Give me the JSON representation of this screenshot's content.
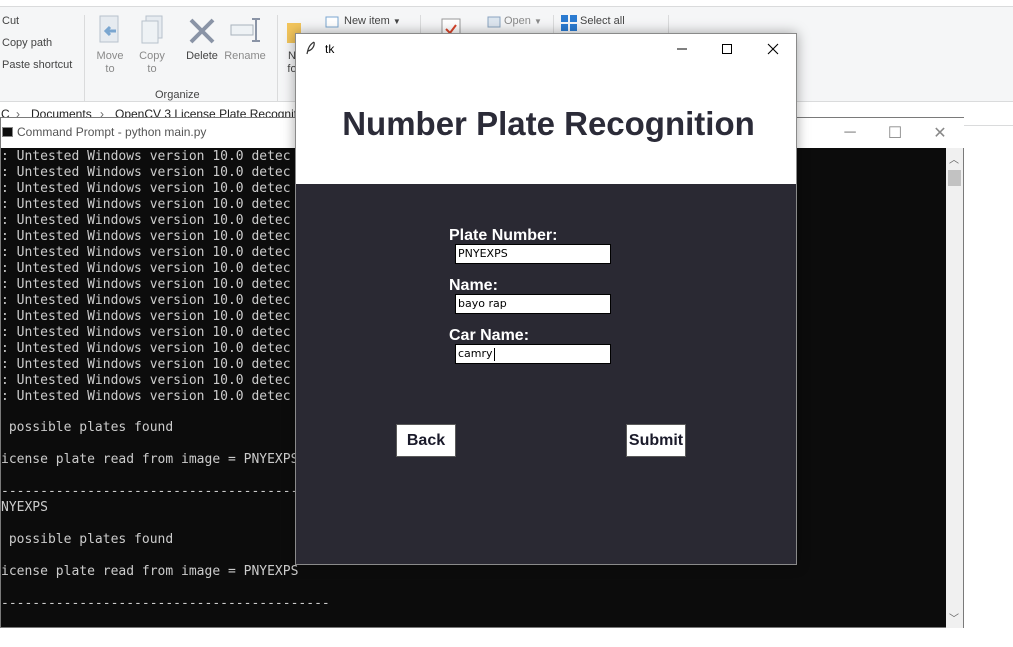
{
  "explorer": {
    "clipboard": {
      "cut": "Cut",
      "copy_path": "Copy path",
      "paste_shortcut": "Paste shortcut"
    },
    "organize": {
      "move_to": "Move to",
      "copy_to": "Copy to",
      "delete": "Delete",
      "rename": "Rename",
      "new_folder_partial": "N fo",
      "group_label": "Organize"
    },
    "new_group": {
      "new_item": "New item",
      "easy_access": ""
    },
    "open_group": {
      "open": "Open"
    },
    "select_group": {
      "select_all": "Select all"
    },
    "address": [
      "C",
      "Documents",
      "OpenCV 3 License Plate Recogniti"
    ]
  },
  "cmd": {
    "title": "Command Prompt - python  main.py",
    "repeated_line": ": Untested Windows version 10.0 detec",
    "repeat_count": 16,
    "lines_after": [
      " possible plates found",
      "icense plate read from image = PNYEXPS",
      "------------------------------------------------",
      "NYEXPS",
      " possible plates found",
      "icense plate read from image = PNYEXPS",
      "------------------------------------------"
    ]
  },
  "tk": {
    "window_title": "tk",
    "app_title": "Number Plate Recognition",
    "fields": {
      "plate": {
        "label": "Plate Number:",
        "value": "PNYEXPS"
      },
      "name": {
        "label": "Name:",
        "value": "bayo rap"
      },
      "car": {
        "label": "Car Name:",
        "value": "camry"
      }
    },
    "back_label": "Back",
    "submit_label": "Submit"
  },
  "colors": {
    "form_background": "#2a2933",
    "title_text": "#2b2b38",
    "console_background": "#0c0c0c",
    "console_text": "#cccccc"
  }
}
